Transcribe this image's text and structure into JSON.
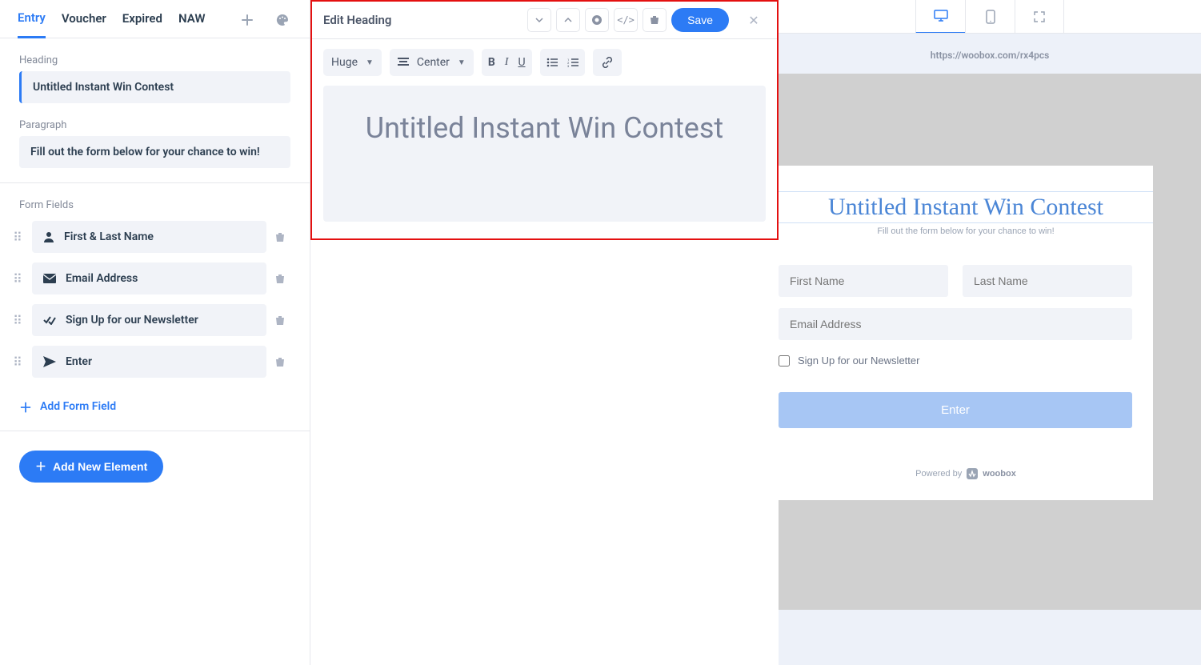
{
  "sidebar": {
    "tabs": [
      {
        "label": "Entry",
        "active": true
      },
      {
        "label": "Voucher"
      },
      {
        "label": "Expired"
      },
      {
        "label": "NAW"
      }
    ],
    "heading_label": "Heading",
    "heading_value": "Untitled Instant Win Contest",
    "paragraph_label": "Paragraph",
    "paragraph_value": "Fill out the form below for your chance to win!",
    "form_fields_label": "Form Fields",
    "fields": [
      {
        "label": "First & Last Name",
        "icon": "user-icon"
      },
      {
        "label": "Email Address",
        "icon": "mail-icon"
      },
      {
        "label": "Sign Up for our Newsletter",
        "icon": "check-icon"
      },
      {
        "label": "Enter",
        "icon": "send-icon"
      }
    ],
    "add_field_label": "Add Form Field",
    "add_element_label": "Add New Element"
  },
  "editor": {
    "title": "Edit Heading",
    "save_label": "Save",
    "size_label": "Huge",
    "align_label": "Center",
    "content": "Untitled Instant Win Contest"
  },
  "preview": {
    "url": "https://woobox.com/rx4pcs",
    "title": "Untitled Instant Win Contest",
    "subtitle": "Fill out the form below for your chance to win!",
    "first_name_placeholder": "First Name",
    "last_name_placeholder": "Last Name",
    "email_placeholder": "Email Address",
    "newsletter_label": "Sign Up for our Newsletter",
    "enter_label": "Enter",
    "powered_label": "Powered by",
    "brand": "woobox"
  }
}
